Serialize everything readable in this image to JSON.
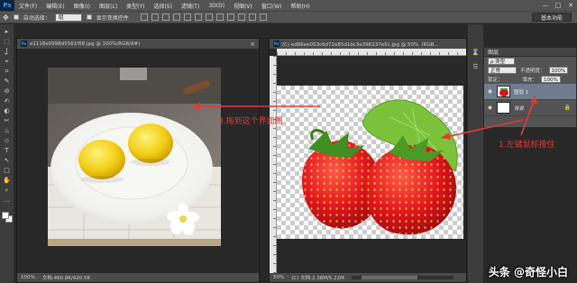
{
  "app": {
    "logo": "Ps"
  },
  "menubar": {
    "items": [
      "文件(F)",
      "编辑(E)",
      "图像(I)",
      "图层(L)",
      "类型(Y)",
      "选择(S)",
      "滤镜(T)",
      "3D(D)",
      "视图(V)",
      "窗口(W)",
      "帮助(H)"
    ],
    "minimize": "—",
    "maximize": "□",
    "close": "✕"
  },
  "options": {
    "auto_select_label": "自动选择：",
    "auto_select_value": "组",
    "show_transform_label": "显示变换控件",
    "workspace": "基本功能"
  },
  "toolbox": {
    "tools": [
      "▸",
      "⬚",
      "ʆ",
      "⌖",
      "⌗",
      "✎",
      "⊘",
      "✍",
      "◐",
      "✂",
      "♨",
      "⬦",
      "T",
      "↖",
      "□",
      "✋",
      "⌕",
      "…"
    ]
  },
  "docs": {
    "left": {
      "title": "e1118e0998d5561f58.jpg @ 100%(RGB/8#)",
      "status": "100%",
      "doc_size": "文档:460.8K/420.5K"
    },
    "right": {
      "title": "(C) ed86ee053c6d72e85d1bc3e396137e5c.jpg @ 50%（RGB...",
      "status": "50%",
      "doc_size": "(C) 文档:2.38M/5.22M"
    }
  },
  "layers_panel": {
    "tab": "图层",
    "kind_label": "ρ 类型",
    "blend_mode": "正常",
    "opacity_label": "不透明度：",
    "opacity_value": "100%",
    "lock_label": "锁定：",
    "fill_label": "填充：",
    "fill_value": "100%",
    "layers": [
      {
        "name": "图层 1",
        "active": true
      },
      {
        "name": "背景",
        "active": false,
        "locked": true
      }
    ]
  },
  "annotations": {
    "drag": "3.拖到这个界面图",
    "press": "1.左键鼠标按住"
  },
  "watermark": "头条 @奇怪小白",
  "colors": {
    "annotation": "#e53935",
    "active_layer": "#6f7c8f"
  }
}
